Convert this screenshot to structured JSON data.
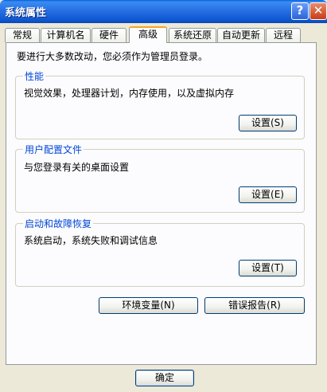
{
  "window": {
    "title": "系统属性"
  },
  "titlebar": {
    "help": "?",
    "close": "✕"
  },
  "tabs": [
    {
      "label": "常规"
    },
    {
      "label": "计算机名"
    },
    {
      "label": "硬件"
    },
    {
      "label": "高级"
    },
    {
      "label": "系统还原"
    },
    {
      "label": "自动更新"
    },
    {
      "label": "远程"
    }
  ],
  "intro": "要进行大多数改动，您必须作为管理员登录。",
  "groups": [
    {
      "title": "性能",
      "description": "视觉效果，处理器计划，内存使用，以及虚拟内存",
      "button": "设置(S)"
    },
    {
      "title": "用户配置文件",
      "description": "与您登录有关的桌面设置",
      "button": "设置(E)"
    },
    {
      "title": "启动和故障恢复",
      "description": "系统启动，系统失败和调试信息",
      "button": "设置(T)"
    }
  ],
  "bottom_buttons": {
    "env": "环境变量(N)",
    "error": "错误报告(R)"
  },
  "footer": {
    "ok": "确定"
  }
}
